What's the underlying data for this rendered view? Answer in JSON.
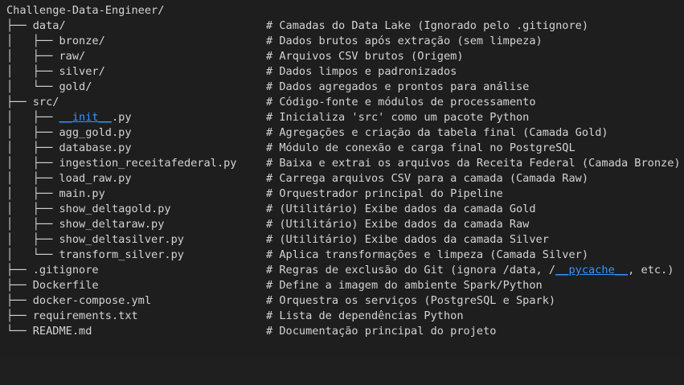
{
  "root": "Challenge-Data-Engineer/",
  "lines": [
    {
      "tree": "├── data/",
      "comment": "# Camadas do Data Lake (Ignorado pelo .gitignore)"
    },
    {
      "tree": "│   ├── bronze/",
      "comment": "# Dados brutos após extração (sem limpeza)"
    },
    {
      "tree": "│   ├── raw/",
      "comment": "# Arquivos CSV brutos (Origem)"
    },
    {
      "tree": "│   ├── silver/",
      "comment": "# Dados limpos e padronizados"
    },
    {
      "tree": "│   └── gold/",
      "comment": "# Dados agregados e prontos para análise"
    },
    {
      "tree": "├── src/",
      "comment": "# Código-fonte e módulos de processamento"
    },
    {
      "tree_prefix": "│   ├── ",
      "tree_link": "__init__",
      "tree_suffix": ".py",
      "comment": "# Inicializa 'src' como um pacote Python"
    },
    {
      "tree": "│   ├── agg_gold.py",
      "comment": "# Agregações e criação da tabela final (Camada Gold)"
    },
    {
      "tree": "│   ├── database.py",
      "comment": "# Módulo de conexão e carga final no PostgreSQL"
    },
    {
      "tree": "│   ├── ingestion_receitafederal.py",
      "comment": "# Baixa e extrai os arquivos da Receita Federal (Camada Bronze)"
    },
    {
      "tree": "│   ├── load_raw.py",
      "comment": "# Carrega arquivos CSV para a camada (Camada Raw)"
    },
    {
      "tree": "│   ├── main.py",
      "comment": "# Orquestrador principal do Pipeline"
    },
    {
      "tree": "│   ├── show_deltagold.py",
      "comment": "# (Utilitário) Exibe dados da camada Gold"
    },
    {
      "tree": "│   ├── show_deltaraw.py",
      "comment": "# (Utilitário) Exibe dados da camada Raw"
    },
    {
      "tree": "│   ├── show_deltasilver.py",
      "comment": "# (Utilitário) Exibe dados da camada Silver"
    },
    {
      "tree": "│   └── transform_silver.py",
      "comment": "# Aplica transformações e limpeza (Camada Silver)"
    },
    {
      "tree": "├── .gitignore",
      "comment_prefix": "# Regras de exclusão do Git (ignora /data, /",
      "comment_link": "__pycache__",
      "comment_suffix": ", etc.)"
    },
    {
      "tree": "├── Dockerfile",
      "comment": "# Define a imagem do ambiente Spark/Python"
    },
    {
      "tree": "├── docker-compose.yml",
      "comment": "# Orquestra os serviços (PostgreSQL e Spark)"
    },
    {
      "tree": "├── requirements.txt",
      "comment": "# Lista de dependências Python"
    },
    {
      "tree": "└── README.md",
      "comment": "# Documentação principal do projeto"
    }
  ],
  "colors": {
    "background": "#1e1e1e",
    "text": "#d4d4d4",
    "link": "#3794ff"
  }
}
